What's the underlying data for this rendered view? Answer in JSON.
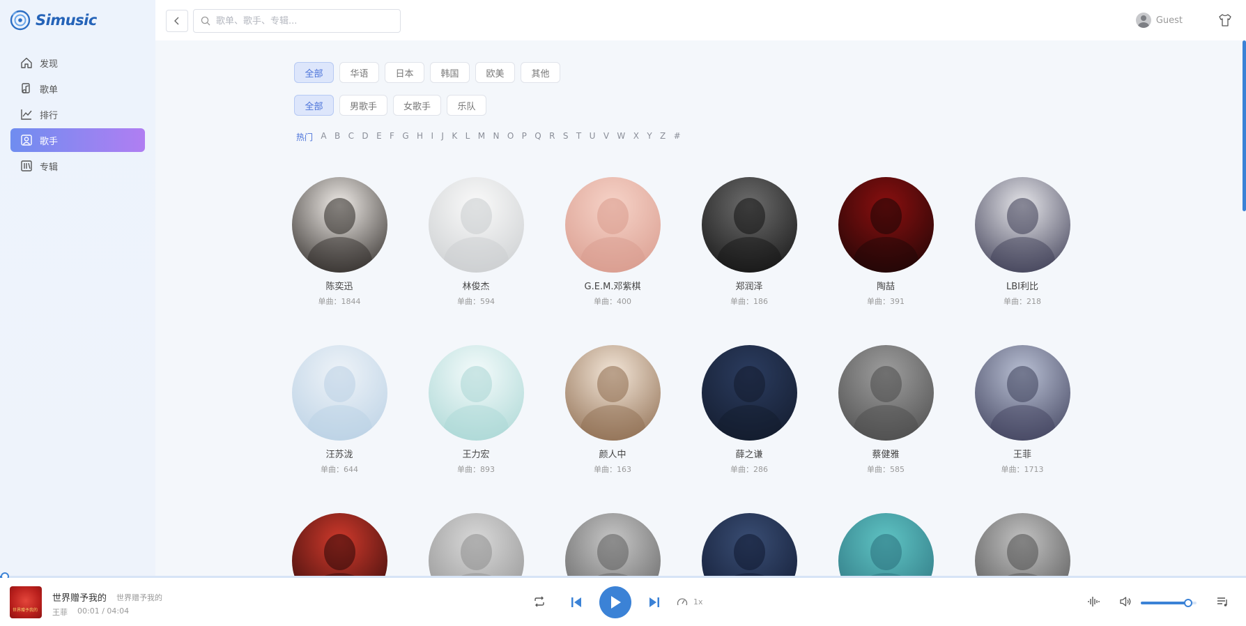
{
  "app": {
    "name": "Simusic"
  },
  "nav": [
    {
      "label": "发现",
      "icon": "home-icon",
      "active": false
    },
    {
      "label": "歌单",
      "icon": "playlist-icon",
      "active": false
    },
    {
      "label": "排行",
      "icon": "chart-icon",
      "active": false
    },
    {
      "label": "歌手",
      "icon": "artist-icon",
      "active": true
    },
    {
      "label": "专辑",
      "icon": "album-icon",
      "active": false
    }
  ],
  "header": {
    "search_placeholder": "歌单、歌手、专辑...",
    "user_name": "Guest"
  },
  "filters": {
    "regions": [
      {
        "label": "全部",
        "active": true
      },
      {
        "label": "华语",
        "active": false
      },
      {
        "label": "日本",
        "active": false
      },
      {
        "label": "韩国",
        "active": false
      },
      {
        "label": "欧美",
        "active": false
      },
      {
        "label": "其他",
        "active": false
      }
    ],
    "types": [
      {
        "label": "全部",
        "active": true
      },
      {
        "label": "男歌手",
        "active": false
      },
      {
        "label": "女歌手",
        "active": false
      },
      {
        "label": "乐队",
        "active": false
      }
    ],
    "letters": [
      "热门",
      "A",
      "B",
      "C",
      "D",
      "E",
      "F",
      "G",
      "H",
      "I",
      "J",
      "K",
      "L",
      "M",
      "N",
      "O",
      "P",
      "Q",
      "R",
      "S",
      "T",
      "U",
      "V",
      "W",
      "X",
      "Y",
      "Z",
      "#"
    ],
    "active_letter": "热门"
  },
  "artists": [
    {
      "name": "陈奕迅",
      "count": "单曲：1844",
      "colors": [
        "#f0ece8",
        "#2a2623"
      ]
    },
    {
      "name": "林俊杰",
      "count": "单曲：594",
      "colors": [
        "#fafafa",
        "#c9ccce"
      ]
    },
    {
      "name": "G.E.M.邓紫棋",
      "count": "单曲：400",
      "colors": [
        "#f6d3c8",
        "#d89a8c"
      ]
    },
    {
      "name": "郑润泽",
      "count": "单曲：186",
      "colors": [
        "#6d6d6d",
        "#121212"
      ]
    },
    {
      "name": "陶喆",
      "count": "单曲：391",
      "colors": [
        "#8a0f0f",
        "#1a0606"
      ]
    },
    {
      "name": "LBI利比",
      "count": "单曲：218",
      "colors": [
        "#e6e6ea",
        "#3a3a52"
      ]
    },
    {
      "name": "汪苏泷",
      "count": "单曲：644",
      "colors": [
        "#eef3f8",
        "#b9d0e4"
      ]
    },
    {
      "name": "王力宏",
      "count": "单曲：893",
      "colors": [
        "#f4fbfb",
        "#a9d6d4"
      ]
    },
    {
      "name": "颜人中",
      "count": "单曲：163",
      "colors": [
        "#f3e6d8",
        "#8c6a4d"
      ]
    },
    {
      "name": "薛之谦",
      "count": "单曲：286",
      "colors": [
        "#2b3c5f",
        "#121a2b"
      ]
    },
    {
      "name": "蔡健雅",
      "count": "单曲：585",
      "colors": [
        "#9e9e9e",
        "#4a4a4a"
      ]
    },
    {
      "name": "王菲",
      "count": "单曲：1713",
      "colors": [
        "#b9c0d4",
        "#3d3f5a"
      ]
    },
    {
      "name": "",
      "count": "",
      "colors": [
        "#d13a2c",
        "#2a0808"
      ]
    },
    {
      "name": "",
      "count": "",
      "colors": [
        "#d9d9d9",
        "#8e8e8e"
      ]
    },
    {
      "name": "",
      "count": "",
      "colors": [
        "#c7c7c7",
        "#5d5d5d"
      ]
    },
    {
      "name": "",
      "count": "",
      "colors": [
        "#3a4e74",
        "#0f1830"
      ]
    },
    {
      "name": "",
      "count": "",
      "colors": [
        "#5fc4c4",
        "#2a6f7c"
      ]
    },
    {
      "name": "",
      "count": "",
      "colors": [
        "#c3c3c3",
        "#4e4e4e"
      ]
    }
  ],
  "player": {
    "title": "世界赠予我的",
    "album": "世界赠予我的",
    "artist": "王菲",
    "time": "00:01 / 04:04",
    "cover_text": "世界赠予我的",
    "speed": "1x",
    "progress": 0.004,
    "volume": 0.85,
    "accent": "#3b82d6"
  }
}
